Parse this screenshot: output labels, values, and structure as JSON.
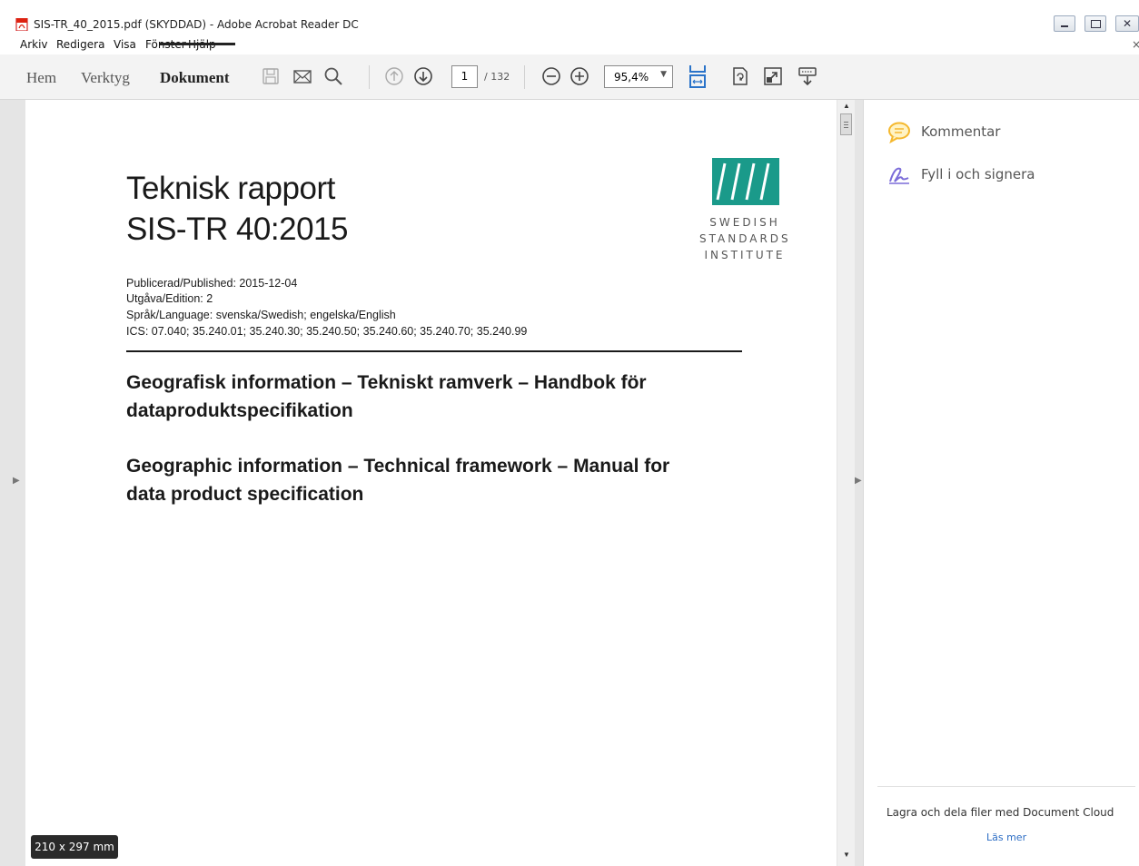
{
  "window": {
    "title": "SIS-TR_40_2015.pdf (SKYDDAD) - Adobe Acrobat Reader DC"
  },
  "menu": {
    "items": [
      "Arkiv",
      "Redigera",
      "Visa",
      "Fönster",
      "Hjälp"
    ],
    "close_glyph": "×"
  },
  "toolbar": {
    "tabs": [
      "Hem",
      "Verktyg",
      "Dokument"
    ],
    "active_tab": "Dokument",
    "current_page": "1",
    "total_pages": "/ 132",
    "zoom": "95,4%",
    "icons": [
      "save-icon",
      "email-icon",
      "search-icon",
      "prev-page-icon",
      "next-page-icon",
      "zoom-out-icon",
      "zoom-in-icon",
      "fit-width-icon",
      "rotate-icon",
      "fullscreen-icon",
      "read-mode-icon"
    ]
  },
  "document": {
    "title_line1": "Teknisk rapport",
    "title_line2": "SIS-TR 40:2015",
    "meta": [
      "Publicerad/Published: 2015-12-04",
      "Utgåva/Edition: 2",
      "Språk/Language: svenska/Swedish; engelska/English",
      "ICS: 07.040; 35.240.01; 35.240.30; 35.240.50; 35.240.60; 35.240.70; 35.240.99"
    ],
    "heading_sv_1": "Geografisk information – Tekniskt ramverk – Handbok för",
    "heading_sv_2": "dataproduktspecifikation",
    "heading_en_1": "Geographic information – Technical framework – Manual for",
    "heading_en_2": "data product specification",
    "logo_lines": [
      "SWEDISH",
      "STANDARDS",
      "INSTITUTE"
    ],
    "logo_color": "#1a9a8a",
    "page_size": "210 x 297 mm"
  },
  "right_pane": {
    "items": [
      "Kommentar",
      "Fyll i och signera"
    ],
    "cloud_text": "Lagra och dela filer med Document Cloud",
    "read_more": "Läs mer"
  }
}
